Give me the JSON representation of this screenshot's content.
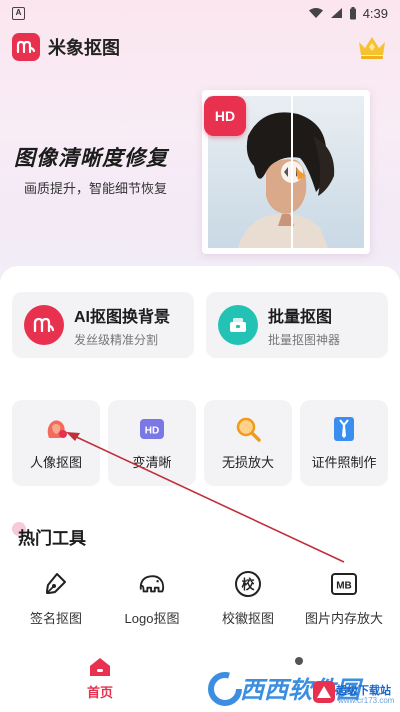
{
  "status_bar": {
    "notification_icon": "A",
    "time": "4:39"
  },
  "header": {
    "logo_text": "m",
    "title": "米象抠图",
    "vip_icon": "crown-icon"
  },
  "banner": {
    "title": "图像清晰度修复",
    "subtitle": "画质提升，智能细节恢复",
    "badge": "HD"
  },
  "features_big": [
    {
      "title": "AI抠图换背景",
      "subtitle": "发丝级精准分割",
      "icon_text": "m",
      "color": "#e8304f"
    },
    {
      "title": "批量抠图",
      "subtitle": "批量抠图神器",
      "icon_text": "",
      "color": "#22c3b4"
    }
  ],
  "features_small": [
    {
      "label": "人像抠图",
      "icon": "portrait-icon"
    },
    {
      "label": "变清晰",
      "icon": "hd-icon",
      "icon_text": "HD"
    },
    {
      "label": "无损放大",
      "icon": "magnifier-icon"
    },
    {
      "label": "证件照制作",
      "icon": "id-photo-icon"
    }
  ],
  "hot_tools": {
    "title": "热门工具",
    "items": [
      {
        "label": "签名抠图",
        "icon": "pen-icon"
      },
      {
        "label": "Logo抠图",
        "icon": "elephant-icon"
      },
      {
        "label": "校徽抠图",
        "icon": "badge-icon",
        "icon_text": "校"
      },
      {
        "label": "图片内存放大",
        "icon": "mb-icon",
        "icon_text": "MB"
      }
    ]
  },
  "bottom_nav": {
    "home_label": "首页"
  },
  "watermark": {
    "brand": "西西软件园",
    "tag": "超级下载站",
    "url": "www.cr173.com"
  },
  "colors": {
    "accent": "#e8304f",
    "teal": "#22c3b4",
    "annotation_arrow": "#c0303a"
  }
}
